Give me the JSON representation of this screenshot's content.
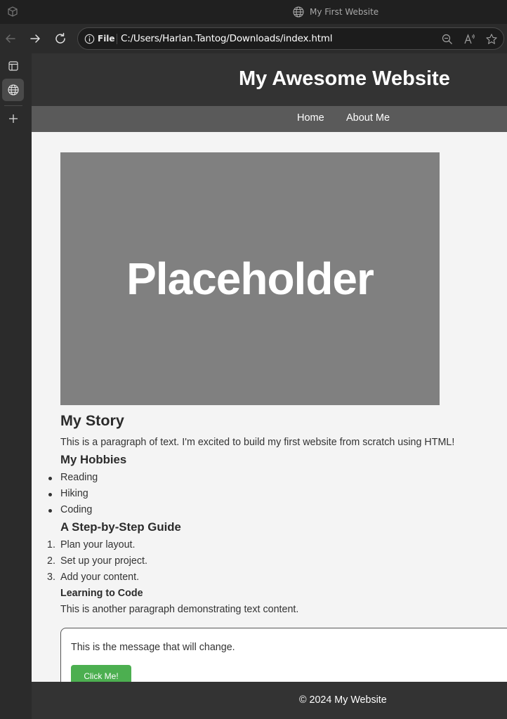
{
  "window": {
    "title": "My First Website"
  },
  "toolbar": {
    "back_icon": "back-arrow-icon",
    "forward_icon": "forward-arrow-icon",
    "refresh_icon": "refresh-icon",
    "address": {
      "scheme_label": "File",
      "url": "C:/Users/Harlan.Tantog/Downloads/index.html"
    }
  },
  "sidebar": {
    "items": [
      {
        "icon": "tab-actions-icon"
      },
      {
        "icon": "globe-icon",
        "active": true
      },
      {
        "icon": "new-tab-plus-icon"
      }
    ]
  },
  "page": {
    "header_title": "My Awesome Website",
    "nav": [
      "Home",
      "About Me"
    ],
    "hero_text": "Placeholder",
    "story_heading": "My Story",
    "story_paragraph": "This is a paragraph of text. I'm excited to build my first website from scratch using HTML!",
    "hobbies_heading": "My Hobbies",
    "hobbies": [
      "Reading",
      "Hiking",
      "Coding"
    ],
    "guide_heading": "A Step-by-Step Guide",
    "guide_steps": [
      "Plan your layout.",
      "Set up your project.",
      "Add your content."
    ],
    "learning_heading": "Learning to Code",
    "learning_paragraph": "This is another paragraph demonstrating text content.",
    "message": "This is the message that will change.",
    "button_label": "Click Me!",
    "footer": "© 2024 My Website"
  },
  "colors": {
    "header_bg": "#333333",
    "nav_bg": "#5a5a5a",
    "page_bg": "#f4f4f4",
    "hero_bg": "#808080",
    "button_bg": "#4caf50"
  }
}
